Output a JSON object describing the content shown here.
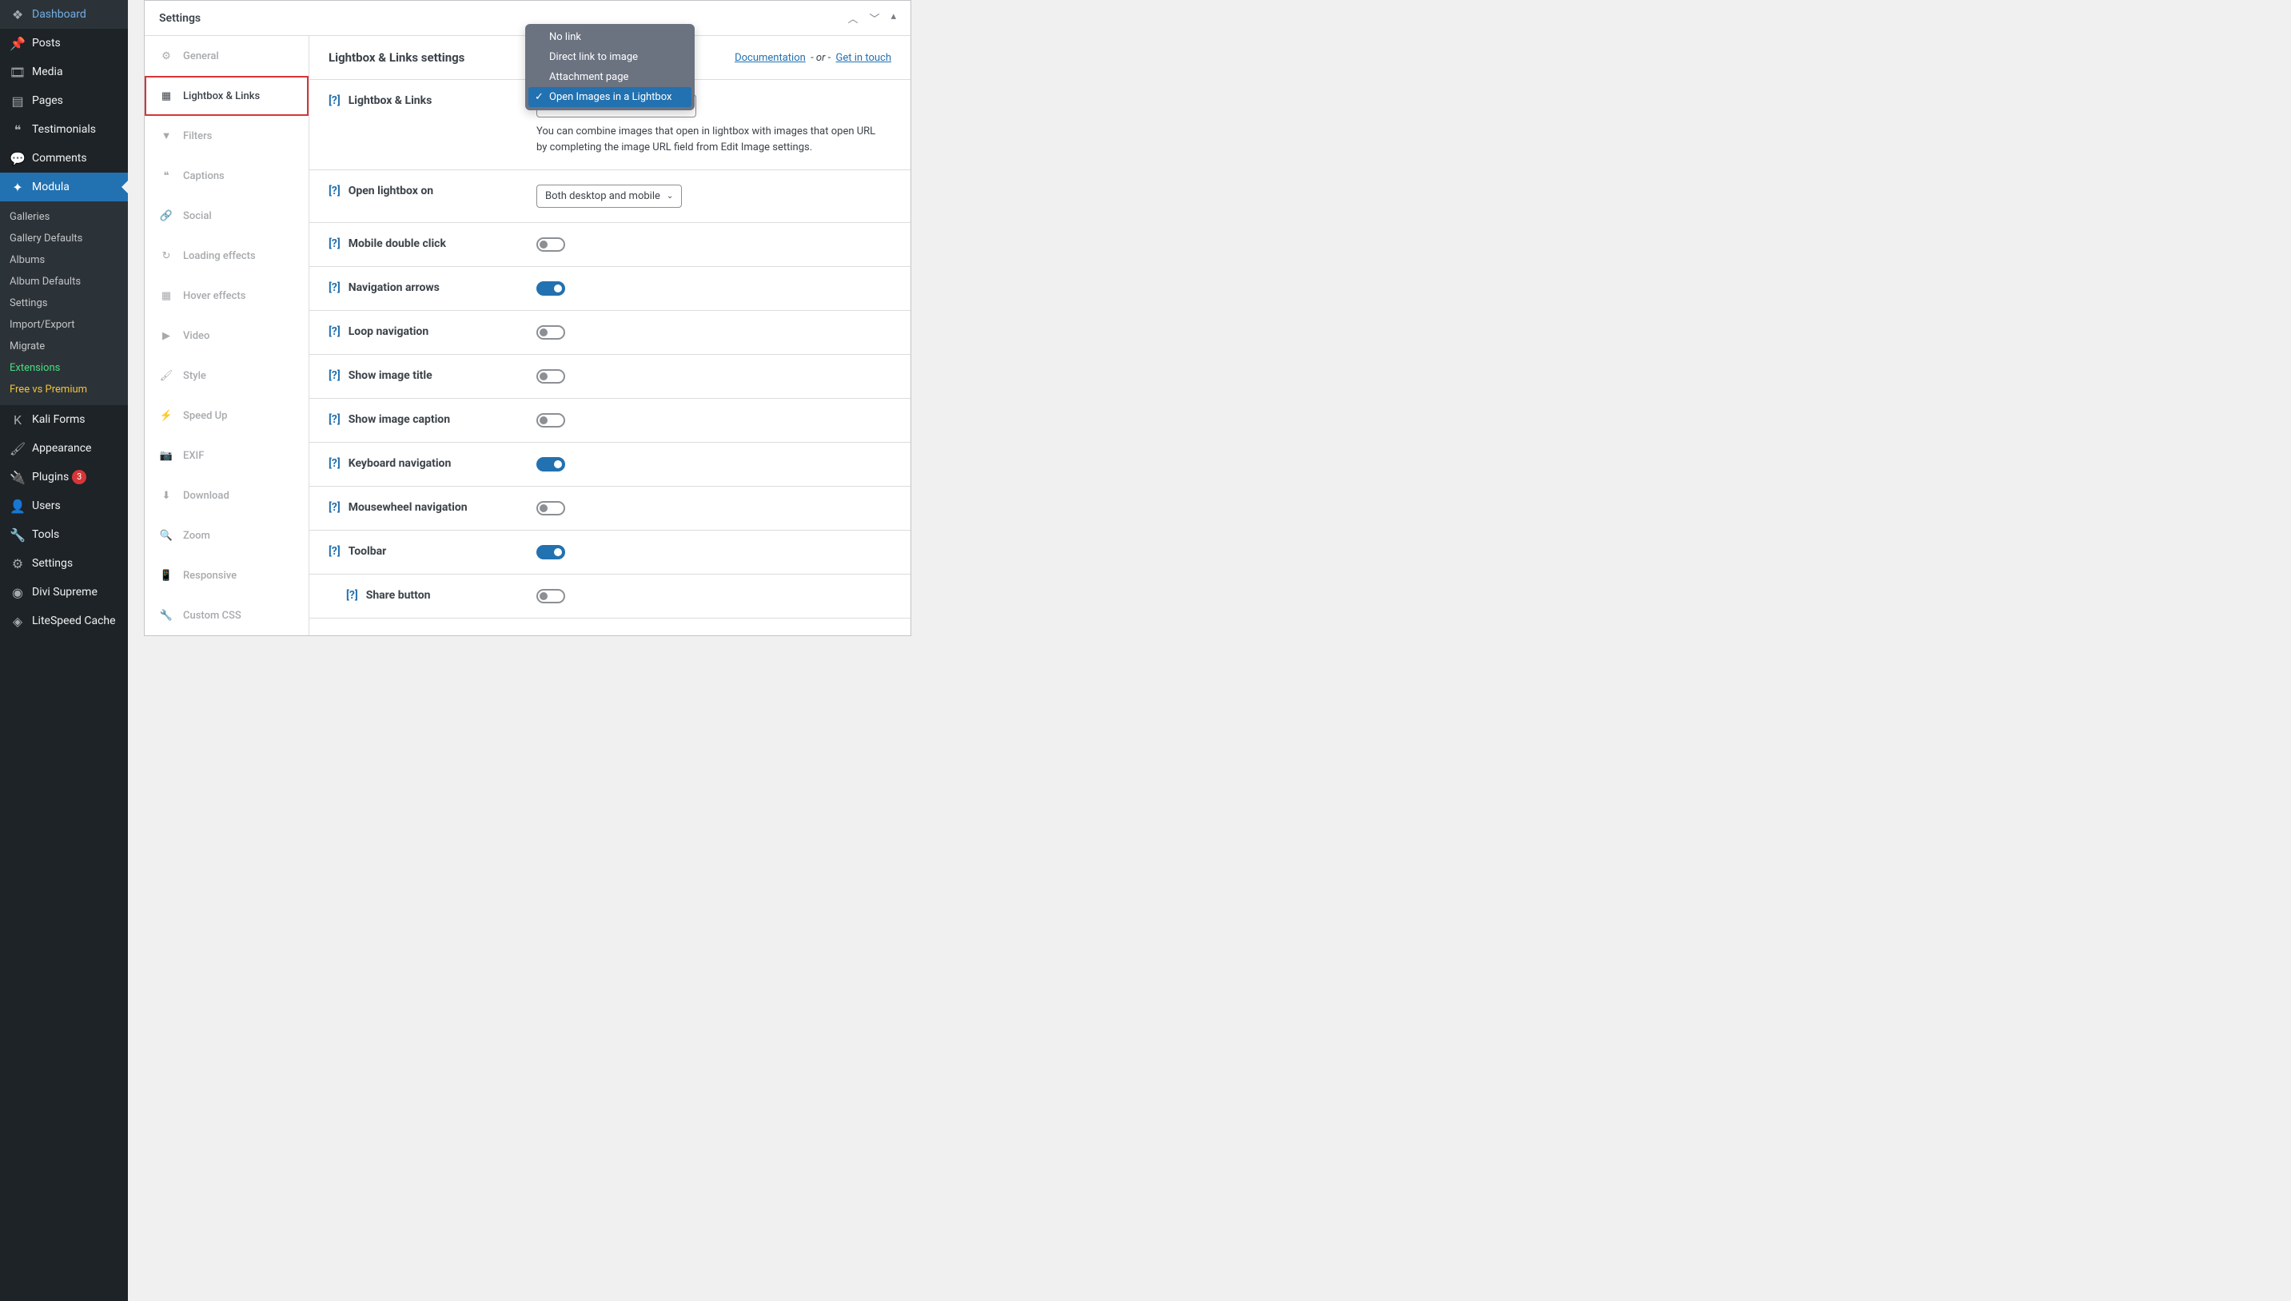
{
  "sidebar": {
    "menu": [
      {
        "label": "Dashboard",
        "icon": "speed"
      },
      {
        "label": "Posts",
        "icon": "pin"
      },
      {
        "label": "Media",
        "icon": "media"
      },
      {
        "label": "Pages",
        "icon": "page"
      },
      {
        "label": "Testimonials",
        "icon": "quote"
      },
      {
        "label": "Comments",
        "icon": "comment"
      },
      {
        "label": "Modula",
        "icon": "modula",
        "active": true
      },
      {
        "label": "Kali Forms",
        "icon": "k"
      },
      {
        "label": "Appearance",
        "icon": "brush"
      },
      {
        "label": "Plugins",
        "icon": "plug",
        "badge": "3"
      },
      {
        "label": "Users",
        "icon": "user"
      },
      {
        "label": "Tools",
        "icon": "wrench"
      },
      {
        "label": "Settings",
        "icon": "sliders"
      },
      {
        "label": "Divi Supreme",
        "icon": "divi"
      },
      {
        "label": "LiteSpeed Cache",
        "icon": "litespeed"
      }
    ],
    "submenu": [
      {
        "label": "Galleries"
      },
      {
        "label": "Gallery Defaults"
      },
      {
        "label": "Albums"
      },
      {
        "label": "Album Defaults"
      },
      {
        "label": "Settings"
      },
      {
        "label": "Import/Export"
      },
      {
        "label": "Migrate"
      },
      {
        "label": "Extensions",
        "cls": "green"
      },
      {
        "label": "Free vs Premium",
        "cls": "yellow"
      }
    ]
  },
  "panel": {
    "title": "Settings",
    "tabs": [
      {
        "label": "General"
      },
      {
        "label": "Lightbox & Links",
        "selected": true
      },
      {
        "label": "Filters"
      },
      {
        "label": "Captions"
      },
      {
        "label": "Social"
      },
      {
        "label": "Loading effects"
      },
      {
        "label": "Hover effects"
      },
      {
        "label": "Video"
      },
      {
        "label": "Style"
      },
      {
        "label": "Speed Up"
      },
      {
        "label": "EXIF"
      },
      {
        "label": "Download"
      },
      {
        "label": "Zoom"
      },
      {
        "label": "Responsive"
      },
      {
        "label": "Custom CSS"
      }
    ]
  },
  "head": {
    "title": "Lightbox & Links settings",
    "doc": "Documentation",
    "or": "- or -",
    "touch": "Get in touch"
  },
  "dropdown": {
    "options": [
      "No link",
      "Direct link to image",
      "Attachment page",
      "Open Images in a Lightbox"
    ],
    "selected_index": 3
  },
  "settings": {
    "lightbox_links": {
      "label": "Lightbox & Links",
      "helper": "You can combine images that open in lightbox with images that open URL by completing the image URL field from Edit Image settings."
    },
    "open_on": {
      "label": "Open lightbox on",
      "value": "Both desktop and mobile"
    },
    "rows": [
      {
        "label": "Mobile double click",
        "on": false
      },
      {
        "label": "Navigation arrows",
        "on": true
      },
      {
        "label": "Loop navigation",
        "on": false
      },
      {
        "label": "Show image title",
        "on": false
      },
      {
        "label": "Show image caption",
        "on": false
      },
      {
        "label": "Keyboard navigation",
        "on": true
      },
      {
        "label": "Mousewheel navigation",
        "on": false
      },
      {
        "label": "Toolbar",
        "on": true
      }
    ],
    "share": {
      "label": "Share button",
      "on": false
    }
  },
  "help": "[?]"
}
